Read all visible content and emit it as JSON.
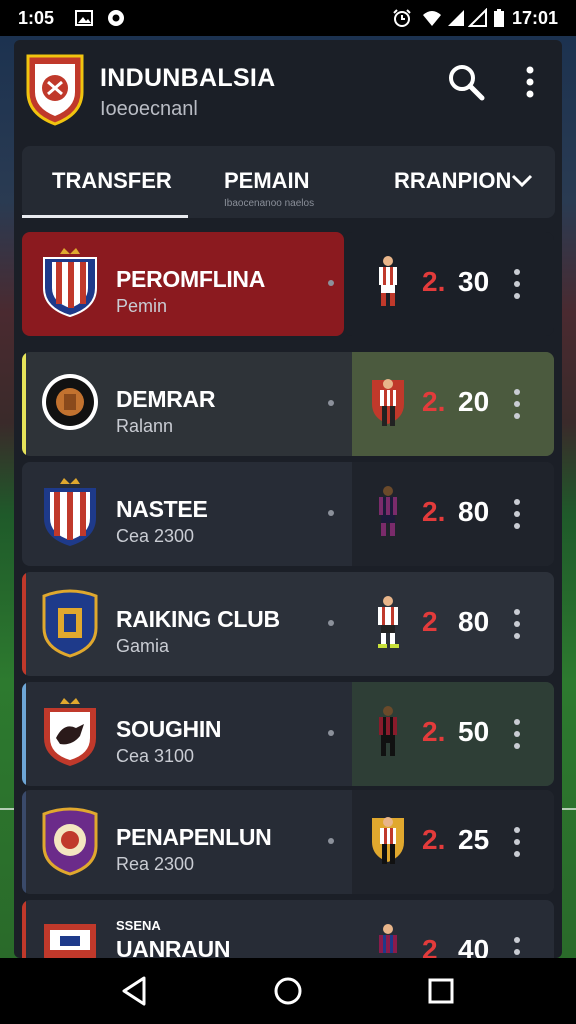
{
  "status_bar": {
    "time_left": "1:05",
    "time_right": "17:01"
  },
  "header": {
    "title": "INDUNBALSIA",
    "subtitle": "Ioeoecnanl"
  },
  "tabs": [
    {
      "label": "TRANSFER",
      "selected": true
    },
    {
      "label": "PEMAIN",
      "hint": "Ibaocenanoo naelos"
    },
    {
      "label": "RRANPION"
    }
  ],
  "clubs": [
    {
      "name": "PEROMFLINA",
      "sub": "Pemin",
      "rank": "2.",
      "score": "30",
      "highlight": "#8b1a1f"
    },
    {
      "name": "DEMRAR",
      "sub": "Ralann",
      "rank": "2.",
      "score": "20",
      "highlight": "#3f4a36"
    },
    {
      "name": "NASTEE",
      "sub": "Cea 2300",
      "rank": "2.",
      "score": "80"
    },
    {
      "name": "RAIKING CLUB",
      "sub": "Gamia",
      "rank": "2",
      "score": "80"
    },
    {
      "name": "SOUGHIN",
      "sub": "Cea 3100",
      "rank": "2.",
      "score": "50"
    },
    {
      "name": "PENAPENLUN",
      "sub": "Rea 2300",
      "rank": "2.",
      "score": "25"
    },
    {
      "name": "UANRAUN",
      "top_label": "SSENA",
      "sub": "",
      "rank": "2",
      "score": "40"
    }
  ],
  "colors": {
    "accent_red": "#e33b3b",
    "panel": "#1b1f27"
  },
  "icons": {
    "search": "search-icon",
    "more": "more-vert-icon",
    "chevron": "chevron-down-icon",
    "nav_back": "back-icon",
    "nav_home": "home-icon",
    "nav_recent": "recent-apps-icon"
  }
}
